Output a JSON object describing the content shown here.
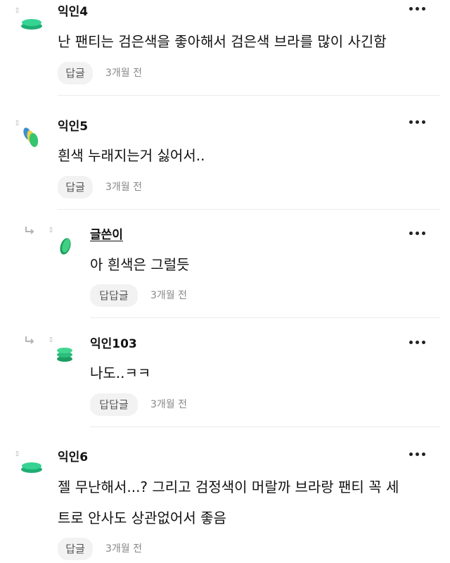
{
  "flag_glyph": "▯",
  "comments": [
    {
      "name": "익인4",
      "lines": [
        "난 팬티는 검은색을 좋아해서 검은색 브라를 많이 사긴함"
      ],
      "reply_label": "답글",
      "time": "3개월 전",
      "avatar_icon": "stacked-discs-icon",
      "avatar_color": "#2ecc8a"
    },
    {
      "name": "익인5",
      "lines": [
        "흰색 누래지는거 싫어서.."
      ],
      "reply_label": "답글",
      "time": "3개월 전",
      "avatar_icon": "tilted-discs-icon",
      "avatar_color": "#3fbf6a"
    },
    {
      "name": "글쓴이",
      "lines": [
        "아 흰색은 그럴듯"
      ],
      "reply_label": "답답글",
      "time": "3개월 전",
      "avatar_icon": "leaf-disc-icon",
      "avatar_color": "#2fb86a"
    },
    {
      "name": "익인103",
      "lines": [
        "나도..ㅋㅋ"
      ],
      "reply_label": "답답글",
      "time": "3개월 전",
      "avatar_icon": "stacked-discs-icon",
      "avatar_color": "#27b36f"
    },
    {
      "name": "익인6",
      "lines": [
        "젤 무난해서...? 그리고 검정색이 머랄까 브라랑 팬티 꼭 세",
        "트로 안사도 상관없어서 좋음"
      ],
      "reply_label": "답글",
      "time": "3개월 전",
      "avatar_icon": "stacked-discs-icon",
      "avatar_color": "#2ecc8a"
    }
  ]
}
